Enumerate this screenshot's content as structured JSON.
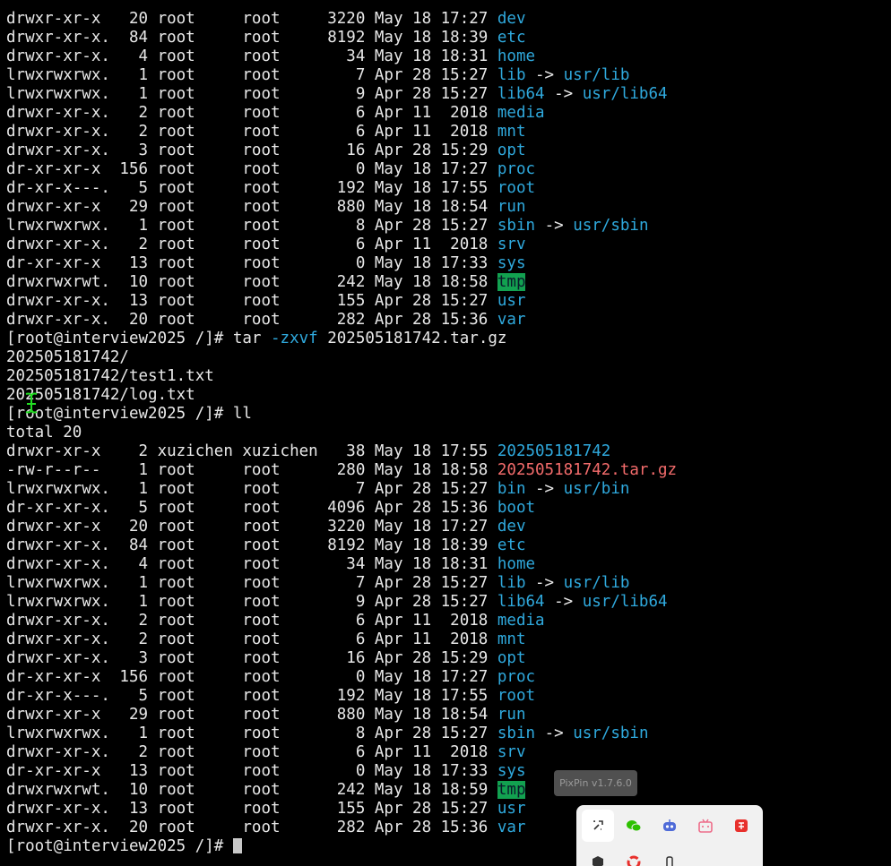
{
  "terminal": {
    "cursor_prompt": "[root@interview2025 /]# ",
    "lines": [
      [
        {
          "t": "drwxr-xr-x   20 root     root     3220 May 18 17:27 "
        },
        {
          "t": "dev",
          "c": "dir"
        }
      ],
      [
        {
          "t": "drwxr-xr-x.  84 root     root     8192 May 18 18:39 "
        },
        {
          "t": "etc",
          "c": "dir"
        }
      ],
      [
        {
          "t": "drwxr-xr-x.   4 root     root       34 May 18 18:31 "
        },
        {
          "t": "home",
          "c": "dir"
        }
      ],
      [
        {
          "t": "lrwxrwxrwx.   1 root     root        7 Apr 28 15:27 "
        },
        {
          "t": "lib",
          "c": "link"
        },
        {
          "t": " -> "
        },
        {
          "t": "usr/lib",
          "c": "dir"
        }
      ],
      [
        {
          "t": "lrwxrwxrwx.   1 root     root        9 Apr 28 15:27 "
        },
        {
          "t": "lib64",
          "c": "link"
        },
        {
          "t": " -> "
        },
        {
          "t": "usr/lib64",
          "c": "dir"
        }
      ],
      [
        {
          "t": "drwxr-xr-x.   2 root     root        6 Apr 11  2018 "
        },
        {
          "t": "media",
          "c": "dir"
        }
      ],
      [
        {
          "t": "drwxr-xr-x.   2 root     root        6 Apr 11  2018 "
        },
        {
          "t": "mnt",
          "c": "dir"
        }
      ],
      [
        {
          "t": "drwxr-xr-x.   3 root     root       16 Apr 28 15:29 "
        },
        {
          "t": "opt",
          "c": "dir"
        }
      ],
      [
        {
          "t": "dr-xr-xr-x  156 root     root        0 May 18 17:27 "
        },
        {
          "t": "proc",
          "c": "dir"
        }
      ],
      [
        {
          "t": "dr-xr-x---.   5 root     root      192 May 18 17:55 "
        },
        {
          "t": "root",
          "c": "dir"
        }
      ],
      [
        {
          "t": "drwxr-xr-x   29 root     root      880 May 18 18:54 "
        },
        {
          "t": "run",
          "c": "dir"
        }
      ],
      [
        {
          "t": "lrwxrwxrwx.   1 root     root        8 Apr 28 15:27 "
        },
        {
          "t": "sbin",
          "c": "link"
        },
        {
          "t": " -> "
        },
        {
          "t": "usr/sbin",
          "c": "dir"
        }
      ],
      [
        {
          "t": "drwxr-xr-x.   2 root     root        6 Apr 11  2018 "
        },
        {
          "t": "srv",
          "c": "dir"
        }
      ],
      [
        {
          "t": "dr-xr-xr-x   13 root     root        0 May 18 17:33 "
        },
        {
          "t": "sys",
          "c": "dir"
        }
      ],
      [
        {
          "t": "drwxrwxrwt.  10 root     root      242 May 18 18:58 "
        },
        {
          "t": "tmp",
          "c": "tmp"
        }
      ],
      [
        {
          "t": "drwxr-xr-x.  13 root     root      155 Apr 28 15:27 "
        },
        {
          "t": "usr",
          "c": "dir"
        }
      ],
      [
        {
          "t": "drwxr-xr-x.  20 root     root      282 Apr 28 15:36 "
        },
        {
          "t": "var",
          "c": "dir"
        }
      ],
      [
        {
          "t": "[root@interview2025 /]# tar "
        },
        {
          "t": "-zxvf",
          "c": "opt"
        },
        {
          "t": " 202505181742.tar.gz"
        }
      ],
      [
        {
          "t": "202505181742/"
        }
      ],
      [
        {
          "t": "202505181742/test1.txt"
        }
      ],
      [
        {
          "t": "202505181742/log.txt"
        }
      ],
      [
        {
          "t": "[root@interview2025 /]# ll"
        }
      ],
      [
        {
          "t": "total 20"
        }
      ],
      [
        {
          "t": "drwxr-xr-x    2 xuzichen xuzichen   38 May 18 17:55 "
        },
        {
          "t": "202505181742",
          "c": "dir"
        }
      ],
      [
        {
          "t": "-rw-r--r--    1 root     root      280 May 18 18:58 "
        },
        {
          "t": "202505181742.tar.gz",
          "c": "arch"
        }
      ],
      [
        {
          "t": "lrwxrwxrwx.   1 root     root        7 Apr 28 15:27 "
        },
        {
          "t": "bin",
          "c": "link"
        },
        {
          "t": " -> "
        },
        {
          "t": "usr/bin",
          "c": "dir"
        }
      ],
      [
        {
          "t": "dr-xr-xr-x.   5 root     root     4096 Apr 28 15:36 "
        },
        {
          "t": "boot",
          "c": "dir"
        }
      ],
      [
        {
          "t": "drwxr-xr-x   20 root     root     3220 May 18 17:27 "
        },
        {
          "t": "dev",
          "c": "dir"
        }
      ],
      [
        {
          "t": "drwxr-xr-x.  84 root     root     8192 May 18 18:39 "
        },
        {
          "t": "etc",
          "c": "dir"
        }
      ],
      [
        {
          "t": "drwxr-xr-x.   4 root     root       34 May 18 18:31 "
        },
        {
          "t": "home",
          "c": "dir"
        }
      ],
      [
        {
          "t": "lrwxrwxrwx.   1 root     root        7 Apr 28 15:27 "
        },
        {
          "t": "lib",
          "c": "link"
        },
        {
          "t": " -> "
        },
        {
          "t": "usr/lib",
          "c": "dir"
        }
      ],
      [
        {
          "t": "lrwxrwxrwx.   1 root     root        9 Apr 28 15:27 "
        },
        {
          "t": "lib64",
          "c": "link"
        },
        {
          "t": " -> "
        },
        {
          "t": "usr/lib64",
          "c": "dir"
        }
      ],
      [
        {
          "t": "drwxr-xr-x.   2 root     root        6 Apr 11  2018 "
        },
        {
          "t": "media",
          "c": "dir"
        }
      ],
      [
        {
          "t": "drwxr-xr-x.   2 root     root        6 Apr 11  2018 "
        },
        {
          "t": "mnt",
          "c": "dir"
        }
      ],
      [
        {
          "t": "drwxr-xr-x.   3 root     root       16 Apr 28 15:29 "
        },
        {
          "t": "opt",
          "c": "dir"
        }
      ],
      [
        {
          "t": "dr-xr-xr-x  156 root     root        0 May 18 17:27 "
        },
        {
          "t": "proc",
          "c": "dir"
        }
      ],
      [
        {
          "t": "dr-xr-x---.   5 root     root      192 May 18 17:55 "
        },
        {
          "t": "root",
          "c": "dir"
        }
      ],
      [
        {
          "t": "drwxr-xr-x   29 root     root      880 May 18 18:54 "
        },
        {
          "t": "run",
          "c": "dir"
        }
      ],
      [
        {
          "t": "lrwxrwxrwx.   1 root     root        8 Apr 28 15:27 "
        },
        {
          "t": "sbin",
          "c": "link"
        },
        {
          "t": " -> "
        },
        {
          "t": "usr/sbin",
          "c": "dir"
        }
      ],
      [
        {
          "t": "drwxr-xr-x.   2 root     root        6 Apr 11  2018 "
        },
        {
          "t": "srv",
          "c": "dir"
        }
      ],
      [
        {
          "t": "dr-xr-xr-x   13 root     root        0 May 18 17:33 "
        },
        {
          "t": "sys",
          "c": "dir"
        }
      ],
      [
        {
          "t": "drwxrwxrwt.  10 root     root      242 May 18 18:59 "
        },
        {
          "t": "tmp",
          "c": "tmp"
        }
      ],
      [
        {
          "t": "drwxr-xr-x.  13 root     root      155 Apr 28 15:27 "
        },
        {
          "t": "usr",
          "c": "dir"
        }
      ],
      [
        {
          "t": "drwxr-xr-x.  20 root     root      282 Apr 28 15:36 "
        },
        {
          "t": "var",
          "c": "dir"
        }
      ]
    ]
  },
  "pixpin": {
    "tooltip": "PixPin v1.7.6.0",
    "buttons": [
      {
        "name": "pin-icon-button",
        "icon": "pin-icon",
        "color": "#333333",
        "active": true
      },
      {
        "name": "wechat-icon-button",
        "icon": "wechat-icon",
        "color": "#2dc100"
      },
      {
        "name": "bot-icon-button",
        "icon": "robot-icon",
        "color": "#4f6bd8"
      },
      {
        "name": "bilibili-icon-button",
        "icon": "tv-icon",
        "color": "#ee6d8a"
      },
      {
        "name": "app-icon-button",
        "icon": "listen-icon",
        "color": "#e8302c"
      }
    ]
  },
  "colors": {
    "background": "#000000",
    "text": "#e8e8e8",
    "directory": "#2fa9dd",
    "archive": "#f26b6b",
    "sticky_dir_bg": "#12a150"
  }
}
